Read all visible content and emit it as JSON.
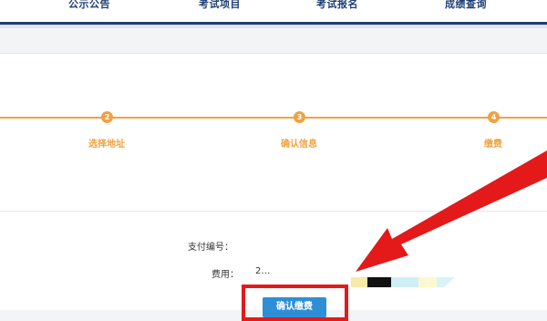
{
  "nav": {
    "items": [
      {
        "label": "公示公告"
      },
      {
        "label": "考试项目"
      },
      {
        "label": "考试报名"
      },
      {
        "label": "成绩查询"
      }
    ]
  },
  "steps": [
    {
      "number": "2",
      "label": "选择地址"
    },
    {
      "number": "3",
      "label": "确认信息"
    },
    {
      "number": "4",
      "label": "缴费"
    }
  ],
  "payment": {
    "order_label": "支付编号：",
    "order_value": "",
    "fee_label": "费用：",
    "fee_value": "2…"
  },
  "confirm_button": {
    "label": "确认缴费"
  },
  "colors": {
    "nav_text": "#1d3f73",
    "step_accent": "#f0a241",
    "highlight": "#e3191a",
    "button": "#2f8fd6"
  }
}
